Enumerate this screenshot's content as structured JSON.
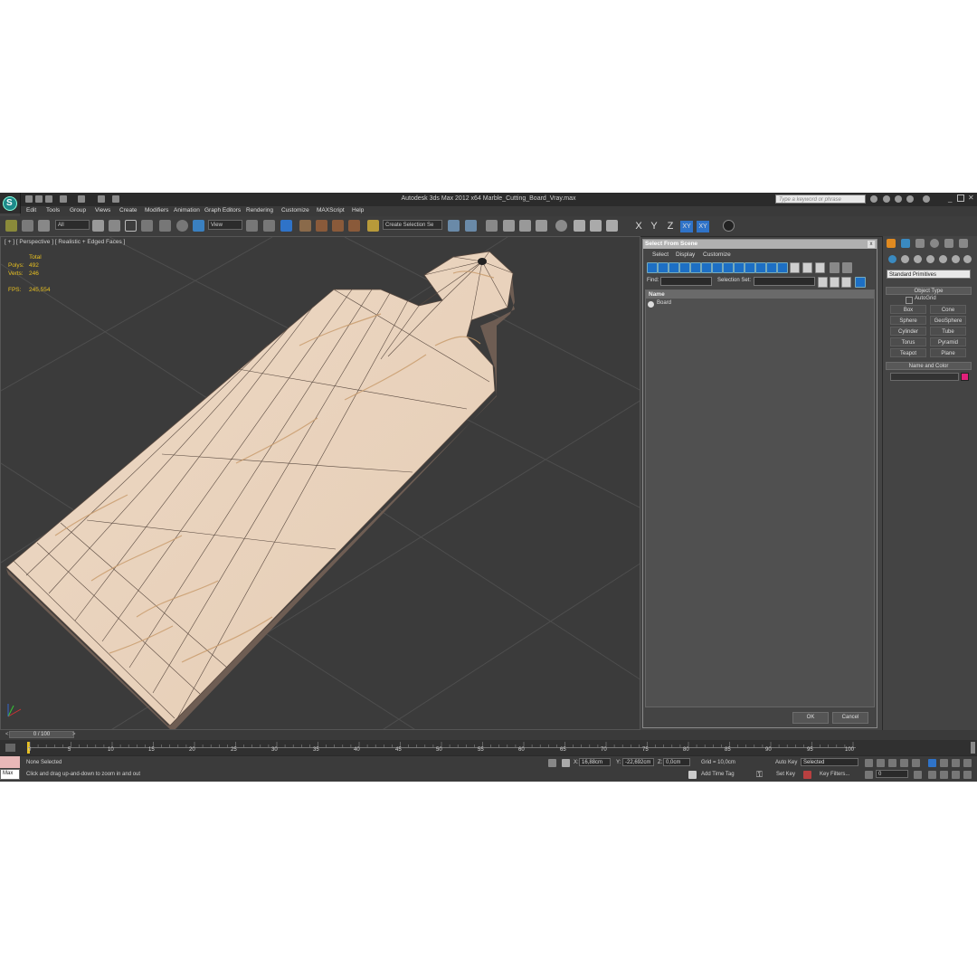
{
  "app": {
    "title": "Autodesk 3ds Max  2012 x64    Marble_Cutting_Board_Vray.max",
    "search_placeholder": "Type a keyword or phrase",
    "logo_letter": "S"
  },
  "menubar": [
    "Edit",
    "Tools",
    "Group",
    "Views",
    "Create",
    "Modifiers",
    "Animation",
    "Graph Editors",
    "Rendering",
    "Customize",
    "MAXScript",
    "Help"
  ],
  "toolbar": {
    "filter_value": "All",
    "refcoord_value": "View",
    "selection_set_placeholder": "Create Selection Se",
    "axis": [
      "X",
      "Y",
      "Z",
      "XY",
      "XY"
    ]
  },
  "viewport": {
    "label": "[ + ] [ Perspective ] [ Realistic + Edged Faces ]",
    "stats": {
      "total_label": "Total",
      "polys_label": "Polys:",
      "polys_value": "492",
      "verts_label": "Verts:",
      "verts_value": "246",
      "fps_label": "FPS:",
      "fps_value": "245,554"
    }
  },
  "dialog": {
    "title": "Select From Scene",
    "close": "x",
    "menus": [
      "Select",
      "Display",
      "Customize"
    ],
    "find_label": "Find:",
    "selection_set_label": "Selection Set:",
    "list_header": "Name",
    "items": [
      "Board"
    ],
    "ok": "OK",
    "cancel": "Cancel"
  },
  "command_panel": {
    "category": "Standard Primitives",
    "object_type": "Object Type",
    "autogrid": "AutoGrid",
    "primitives": [
      "Box",
      "Cone",
      "Sphere",
      "GeoSphere",
      "Cylinder",
      "Tube",
      "Torus",
      "Pyramid",
      "Teapot",
      "Plane"
    ],
    "name_and_color": "Name and Color",
    "object_color": "#e0207a"
  },
  "timeline": {
    "frame_display": "0 / 100",
    "ticks": [
      "0",
      "5",
      "10",
      "15",
      "20",
      "25",
      "30",
      "35",
      "40",
      "45",
      "50",
      "55",
      "60",
      "65",
      "70",
      "75",
      "80",
      "85",
      "90",
      "95",
      "100"
    ]
  },
  "status": {
    "selection": "None Selected",
    "prompt": "Click and drag up-and-down to zoom in and out",
    "maxscript": "Max",
    "x_label": "X:",
    "x_value": "16,88cm",
    "y_label": "Y:",
    "y_value": "-22,692cm",
    "z_label": "Z:",
    "z_value": "0,0cm",
    "grid": "Grid = 10,0cm",
    "add_time_tag": "Add Time Tag",
    "auto_key": "Auto Key",
    "auto_key_mode": "Selected",
    "set_key": "Set Key",
    "key_filters": "Key Filters...",
    "frame": "0"
  }
}
